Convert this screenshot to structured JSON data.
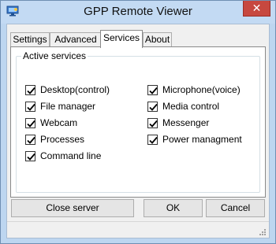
{
  "window": {
    "title": "GPP Remote Viewer",
    "close_glyph": "✕",
    "icon": "app-monitor-icon"
  },
  "tabs": [
    {
      "label": "Settings"
    },
    {
      "label": "Advanced"
    },
    {
      "label": "Services",
      "active": true
    },
    {
      "label": "About"
    }
  ],
  "services": {
    "group_label": "Active services",
    "left": [
      {
        "label": "Desktop(control)",
        "checked": true
      },
      {
        "label": "File manager",
        "checked": true
      },
      {
        "label": "Webcam",
        "checked": true
      },
      {
        "label": "Processes",
        "checked": true
      },
      {
        "label": "Command line",
        "checked": true
      }
    ],
    "right": [
      {
        "label": "Microphone(voice)",
        "checked": true
      },
      {
        "label": "Media control",
        "checked": true
      },
      {
        "label": "Messenger",
        "checked": true
      },
      {
        "label": "Power managment",
        "checked": true
      }
    ]
  },
  "buttons": {
    "close_server": "Close server",
    "ok": "OK",
    "cancel": "Cancel"
  },
  "colors": {
    "frame": "#bdd6f0",
    "close_button": "#c7483f",
    "client_bg": "#f0f0f0"
  }
}
